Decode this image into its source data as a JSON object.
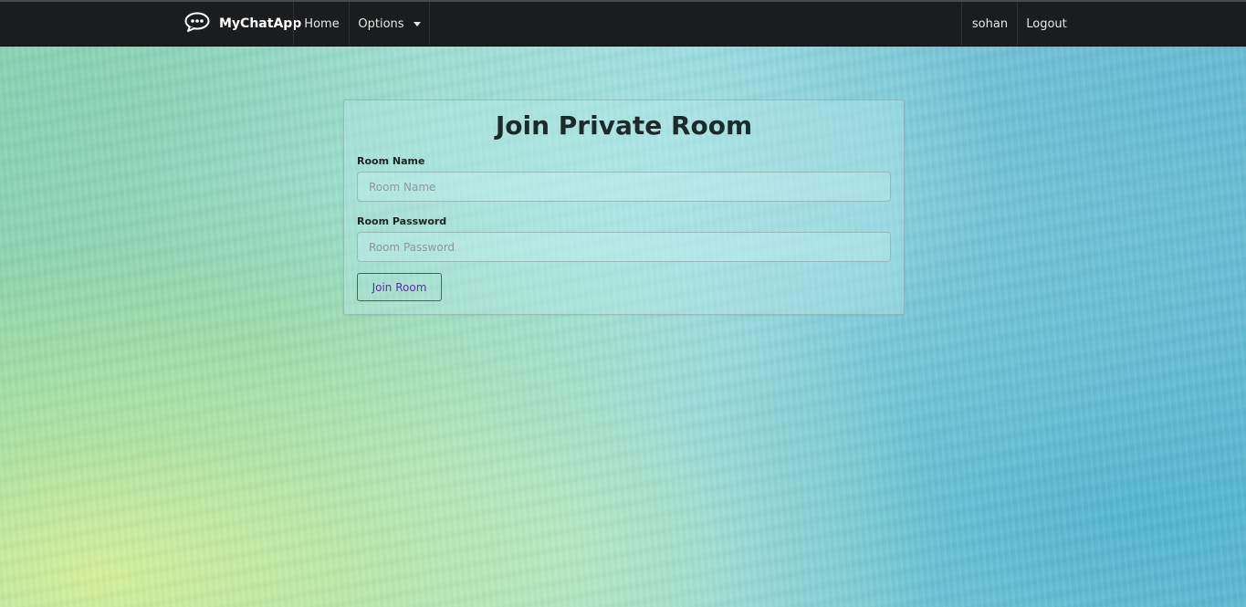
{
  "navbar": {
    "brand": "MyChatApp",
    "brand_icon": "speech-bubble-icon",
    "home": "Home",
    "options": "Options",
    "user": "sohan",
    "logout": "Logout"
  },
  "form": {
    "title": "Join Private Room",
    "room_name_label": "Room Name",
    "room_name_placeholder": "Room Name",
    "room_name_value": "",
    "room_password_label": "Room Password",
    "room_password_placeholder": "Room Password",
    "room_password_value": "",
    "submit_label": "Join Room"
  },
  "colors": {
    "navbar_bg": "#1b1c1e",
    "button_accent": "#6a3fb5"
  }
}
